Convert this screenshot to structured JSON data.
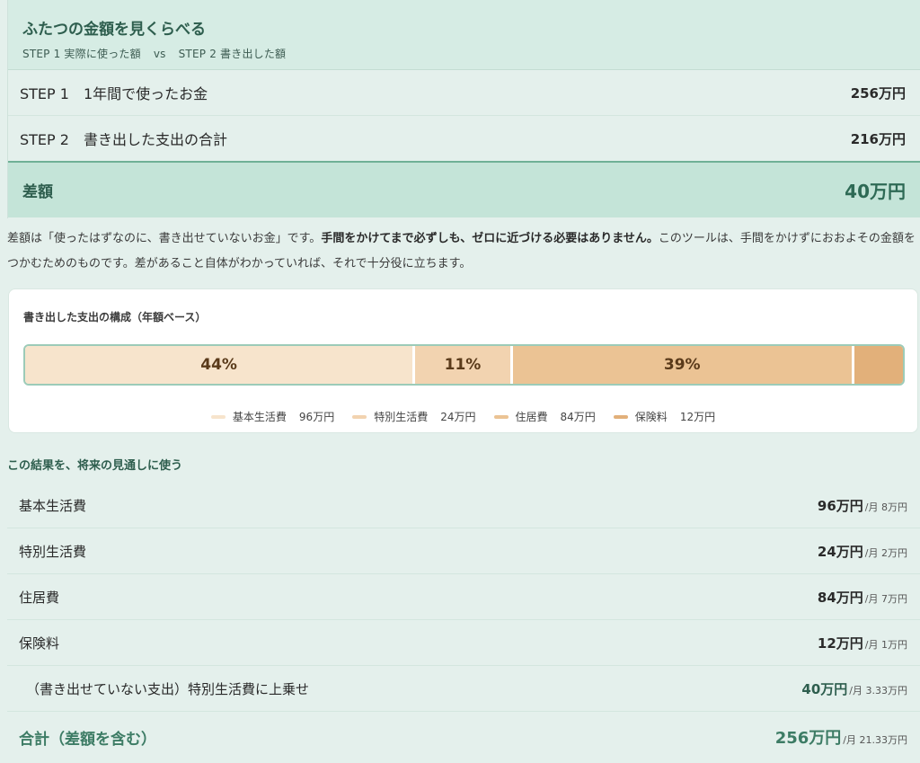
{
  "compare": {
    "title": "ふたつの金額を見くらべる",
    "step1_tag": "STEP 1 実際に使った額",
    "vs": "vs",
    "step2_tag": "STEP 2 書き出した額",
    "rows": [
      {
        "label": "STEP 1　1年間で使ったお金",
        "value": "256万円"
      },
      {
        "label": "STEP 2　書き出した支出の合計",
        "value": "216万円"
      }
    ],
    "diff_label": "差額",
    "diff_value": "40万円"
  },
  "note": {
    "part1": "差額は「使ったはずなのに、書き出せていないお金」です。",
    "bold": "手間をかけてまで必ずしも、ゼロに近づける必要はありません。",
    "part2": "このツールは、手間をかけずにおおよその金額をつかむためのものです。差があること自体がわかっていれば、それで十分役に立ちます。"
  },
  "composition": {
    "title": "書き出した支出の構成（年額ベース）",
    "segments": [
      {
        "name": "基本生活費",
        "amount": "96万円",
        "value": 96,
        "pct_label": "44%",
        "color": "#f7e4cc"
      },
      {
        "name": "特別生活費",
        "amount": "24万円",
        "value": 24,
        "pct_label": "11%",
        "color": "#f2d3b0"
      },
      {
        "name": "住居費",
        "amount": "84万円",
        "value": 84,
        "pct_label": "39%",
        "color": "#ebc394"
      },
      {
        "name": "保険料",
        "amount": "12万円",
        "value": 12,
        "pct_label": "",
        "color": "#e2b07a"
      }
    ]
  },
  "projection": {
    "title": "この結果を、将来の見通しに使う",
    "rows": [
      {
        "label": "基本生活費",
        "amount": "96万円",
        "monthly": "/月 8万円"
      },
      {
        "label": "特別生活費",
        "amount": "24万円",
        "monthly": "/月 2万円"
      },
      {
        "label": "住居費",
        "amount": "84万円",
        "monthly": "/月 7万円"
      },
      {
        "label": "保険料",
        "amount": "12万円",
        "monthly": "/月 1万円"
      },
      {
        "label": "（書き出せていない支出）特別生活費に上乗せ",
        "amount": "40万円",
        "monthly": "/月 3.33万円"
      }
    ],
    "total": {
      "label": "合計（差額を含む）",
      "amount": "256万円",
      "monthly": "/月 21.33万円"
    }
  }
}
